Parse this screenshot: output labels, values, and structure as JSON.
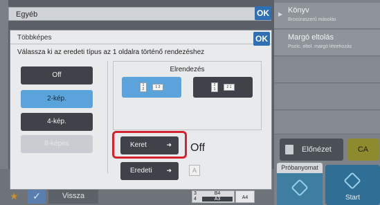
{
  "top_dialog": {
    "title": "Egyéb",
    "ok_label": "OK"
  },
  "main_dialog": {
    "title": "Többképes",
    "ok_label": "OK",
    "instruction": "Válassza ki az eredeti típus az 1 oldalra történő rendezéshez",
    "options": [
      {
        "label": "Off",
        "state": "normal"
      },
      {
        "label": "2-kép.",
        "state": "selected"
      },
      {
        "label": "4-kép.",
        "state": "normal"
      },
      {
        "label": "8-képes",
        "state": "disabled"
      }
    ],
    "layout": {
      "label": "Elrendezés",
      "option1_pages": [
        "1",
        "2"
      ],
      "option1_result": "1 2",
      "option2_pages": [
        "2",
        "1"
      ],
      "option2_result": "2 1"
    },
    "keret": {
      "label": "Keret",
      "value": "Off"
    },
    "eredeti": {
      "label": "Eredeti",
      "icon_text": "A"
    }
  },
  "right_panel": {
    "items": [
      {
        "title": "Könyv",
        "subtitle": "Brosúraszerű másolás"
      },
      {
        "title": "Margó eltolás",
        "subtitle": "Pozíc. eltol. margó létrehozás"
      }
    ],
    "elonezet_label": "Előnézet",
    "ca_label": "CA",
    "probanyomat_label": "Próbanyomat",
    "start_label": "Start"
  },
  "bottom_bar": {
    "vissza_label": "Vissza",
    "tray_rows": [
      {
        "num": "3",
        "paper": "B4"
      },
      {
        "num": "4",
        "paper": "A3"
      }
    ],
    "tray_paper_right": "A4"
  },
  "colors": {
    "accent": "#5aa3db",
    "ok_blue": "#2f6fb3",
    "highlight_red": "#d4232f",
    "ca": "#8e8a2e"
  }
}
